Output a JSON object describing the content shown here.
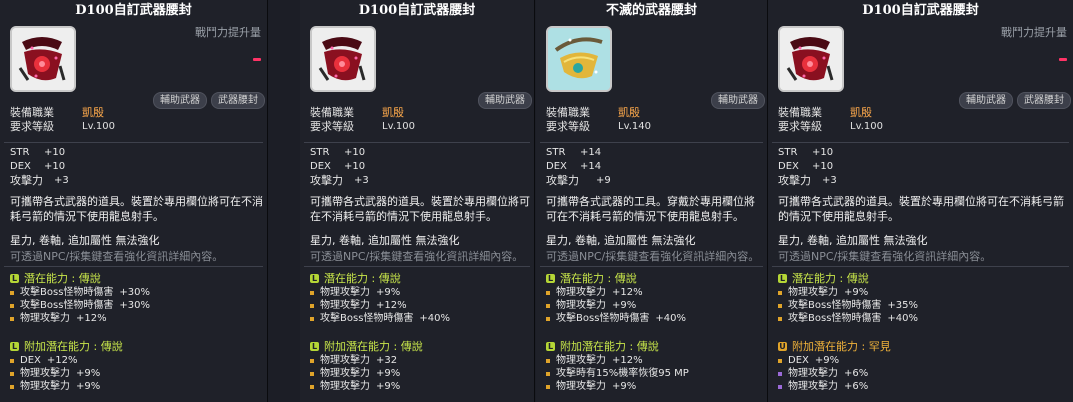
{
  "colors": {
    "legendary": "#b5d636",
    "rare": "#e0a42a",
    "job": "#f7a54a",
    "bg": "#1f2129"
  },
  "panels": [
    {
      "title": "D100自訂武器腰封",
      "power_label": "戰鬥力提升量",
      "tags": [
        "輔助武器",
        "武器腰封"
      ],
      "icon": "red-weapon-belt-icon",
      "req": {
        "job_label": "裝備職業",
        "job_value": "凱殷",
        "level_label": "要求等級",
        "level_value": "Lv.100"
      },
      "stats": [
        {
          "k": "STR",
          "v": "+10"
        },
        {
          "k": "DEX",
          "v": "+10"
        },
        {
          "k": "攻擊力",
          "v": "+3"
        }
      ],
      "desc": "可攜帶各式武器的道具。裝置於專用欄位將可在不消耗弓箭的情況下使用龍息射手。",
      "star": "星力, 卷軸, 追加屬性 無法強化",
      "hint": "可透過NPC/採集鍵查看強化資訊詳細內容。",
      "potential": {
        "label": "潛在能力 : 傳說",
        "badge": "L",
        "lines": [
          {
            "k": "攻擊Boss怪物時傷害",
            "v": "+30%"
          },
          {
            "k": "攻擊Boss怪物時傷害",
            "v": "+30%"
          },
          {
            "k": "物理攻擊力",
            "v": "+12%"
          }
        ]
      },
      "bonus": {
        "label": "附加潛在能力 : 傳說",
        "badge": "L",
        "lines": [
          {
            "k": "DEX",
            "v": "+12%"
          },
          {
            "k": "物理攻擊力",
            "v": "+9%"
          },
          {
            "k": "物理攻擊力",
            "v": "+9%"
          }
        ]
      }
    },
    {
      "title": "D100自訂武器腰封",
      "power_label": "",
      "tags": [
        "輔助武器"
      ],
      "icon": "red-weapon-belt-icon",
      "req": {
        "job_label": "裝備職業",
        "job_value": "凱殷",
        "level_label": "要求等級",
        "level_value": "Lv.100"
      },
      "stats": [
        {
          "k": "STR",
          "v": "+10"
        },
        {
          "k": "DEX",
          "v": "+10"
        },
        {
          "k": "攻擊力",
          "v": "+3"
        }
      ],
      "desc": "可攜帶各式武器的道具。裝置於專用欄位將可在不消耗弓箭的情況下使用龍息射手。",
      "star": "星力, 卷軸, 追加屬性 無法強化",
      "hint": "可透過NPC/採集鍵查看強化資訊詳細內容。",
      "potential": {
        "label": "潛在能力 : 傳說",
        "badge": "L",
        "lines": [
          {
            "k": "物理攻擊力",
            "v": "+9%"
          },
          {
            "k": "物理攻擊力",
            "v": "+12%"
          },
          {
            "k": "攻擊Boss怪物時傷害",
            "v": "+40%"
          }
        ]
      },
      "bonus": {
        "label": "附加潛在能力 : 傳說",
        "badge": "L",
        "lines": [
          {
            "k": "物理攻擊力",
            "v": "+32"
          },
          {
            "k": "物理攻擊力",
            "v": "+9%"
          },
          {
            "k": "物理攻擊力",
            "v": "+9%"
          }
        ]
      }
    },
    {
      "title": "不滅的武器腰封",
      "power_label": "",
      "tags": [
        "輔助武器"
      ],
      "icon": "gold-weapon-belt-icon",
      "req": {
        "job_label": "裝備職業",
        "job_value": "凱殷",
        "level_label": "要求等級",
        "level_value": "Lv.140"
      },
      "stats": [
        {
          "k": "STR",
          "v": "+14"
        },
        {
          "k": "DEX",
          "v": "+14"
        },
        {
          "k": "攻擊力",
          "v": "+9"
        }
      ],
      "desc": "可攜帶各式武器的工具。穿戴於專用欄位將可在不消耗弓箭的情況下使用龍息射手。",
      "star": "星力, 卷軸, 追加屬性 無法強化",
      "hint": "可透過NPC/採集鍵查看強化資訊詳細內容。",
      "potential": {
        "label": "潛在能力 : 傳說",
        "badge": "L",
        "lines": [
          {
            "k": "物理攻擊力",
            "v": "+12%"
          },
          {
            "k": "物理攻擊力",
            "v": "+9%"
          },
          {
            "k": "攻擊Boss怪物時傷害",
            "v": "+40%"
          }
        ]
      },
      "bonus": {
        "label": "附加潛在能力 : 傳說",
        "badge": "L",
        "lines": [
          {
            "k": "物理攻擊力",
            "v": "+12%"
          },
          {
            "k": "攻擊時有15%機率恢復95 MP",
            "v": ""
          },
          {
            "k": "物理攻擊力",
            "v": "+9%"
          }
        ]
      }
    },
    {
      "title": "D100自訂武器腰封",
      "power_label": "戰鬥力提升量",
      "tags": [
        "輔助武器",
        "武器腰封"
      ],
      "icon": "red-weapon-belt-icon",
      "req": {
        "job_label": "裝備職業",
        "job_value": "凱殷",
        "level_label": "要求等級",
        "level_value": "Lv.100"
      },
      "stats": [
        {
          "k": "STR",
          "v": "+10"
        },
        {
          "k": "DEX",
          "v": "+10"
        },
        {
          "k": "攻擊力",
          "v": "+3"
        }
      ],
      "desc": "可攜帶各式武器的道具。裝置於專用欄位將可在不消耗弓箭的情況下使用龍息射手。",
      "star": "星力, 卷軸, 追加屬性 無法強化",
      "hint": "可透過NPC/採集鍵查看強化資訊詳細內容。",
      "potential": {
        "label": "潛在能力 : 傳說",
        "badge": "L",
        "lines": [
          {
            "k": "物理攻擊力",
            "v": "+9%"
          },
          {
            "k": "攻擊Boss怪物時傷害",
            "v": "+35%"
          },
          {
            "k": "攻擊Boss怪物時傷害",
            "v": "+40%"
          }
        ]
      },
      "bonus": {
        "label": "附加潛在能力 : 罕見",
        "badge": "U",
        "lines": [
          {
            "k": "DEX",
            "v": "+9%"
          },
          {
            "k": "物理攻擊力",
            "v": "+6%"
          },
          {
            "k": "物理攻擊力",
            "v": "+6%"
          }
        ]
      }
    }
  ]
}
